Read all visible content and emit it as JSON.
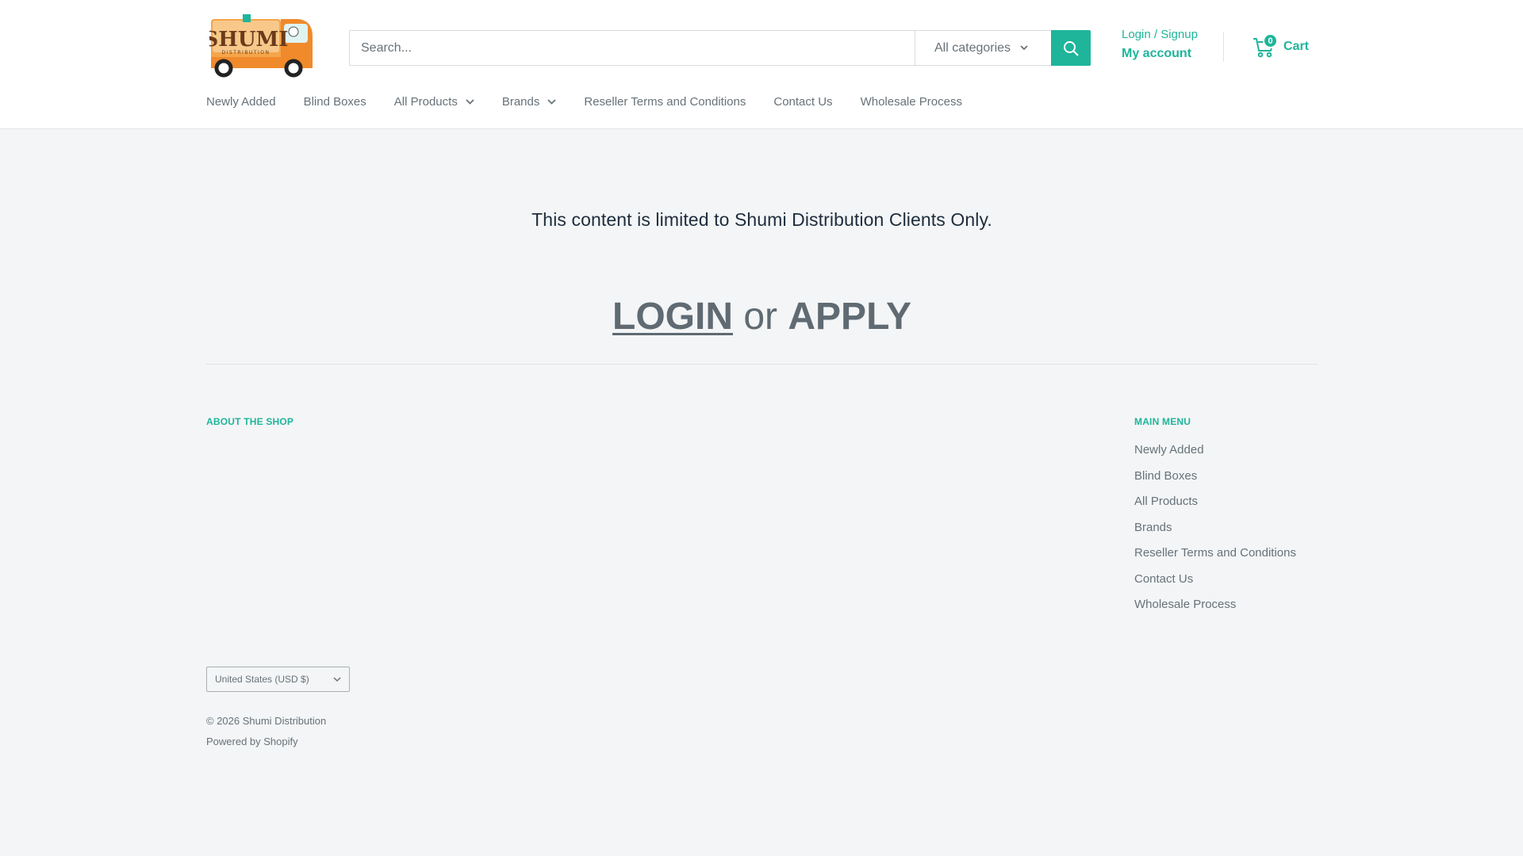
{
  "brand": {
    "logo_text": "SHUMI",
    "logo_subtext": "DISTRIBUTION"
  },
  "search": {
    "placeholder": "Search...",
    "category": "All categories"
  },
  "account": {
    "login_signup": "Login / Signup",
    "my_account": "My account"
  },
  "cart": {
    "count": "0",
    "label": "Cart"
  },
  "nav": {
    "items": [
      {
        "label": "Newly Added"
      },
      {
        "label": "Blind Boxes"
      },
      {
        "label": "All Products",
        "dropdown": true
      },
      {
        "label": "Brands",
        "dropdown": true
      },
      {
        "label": "Reseller Terms and Conditions"
      },
      {
        "label": "Contact Us"
      },
      {
        "label": "Wholesale Process"
      }
    ]
  },
  "main": {
    "restricted_message": "This content is limited to Shumi Distribution Clients Only.",
    "login": "LOGIN",
    "or": "or",
    "apply": "APPLY"
  },
  "footer": {
    "about_heading": "ABOUT THE SHOP",
    "menu_heading": "MAIN MENU",
    "menu_items": [
      "Newly Added",
      "Blind Boxes",
      "All Products",
      "Brands",
      "Reseller Terms and Conditions",
      "Contact Us",
      "Wholesale Process"
    ],
    "currency": "United States (USD $)",
    "copyright": "© 2026 Shumi Distribution",
    "powered_by": "Powered by Shopify"
  },
  "colors": {
    "accent": "#1eb59a",
    "text_muted": "#677279",
    "cta": "#5f6a72",
    "background": "#f3f5f6"
  }
}
